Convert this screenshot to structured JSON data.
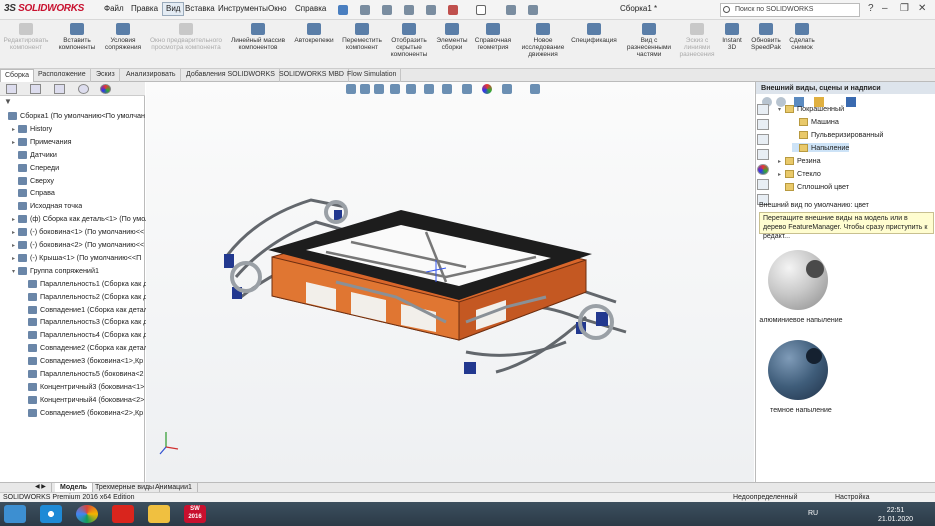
{
  "titlebar": {
    "logo_ds": "3S",
    "logo_name": "SOLIDWORKS",
    "menus": [
      "Файл",
      "Правка",
      "Вид",
      "Вставка",
      "Инструменты",
      "Окно",
      "Справка"
    ],
    "doc_title": "Сборка1 *",
    "search_placeholder": "Поиск по SOLIDWORKS",
    "search_glyph": "🔍",
    "help_glyph": "?",
    "min_glyph": "–",
    "max_glyph": "❐",
    "close_glyph": "✕"
  },
  "ribbon": {
    "items": [
      {
        "label": "Редактировать компонент",
        "disabled": true
      },
      {
        "label": "Вставить компоненты",
        "disabled": false
      },
      {
        "label": "Условия сопряжения",
        "disabled": false
      },
      {
        "label": "Окно предварительного просмотра компонента",
        "disabled": true
      },
      {
        "label": "Линейный массив компонентов",
        "disabled": false
      },
      {
        "label": "Автокрепежи",
        "disabled": false
      },
      {
        "label": "Переместить компонент",
        "disabled": false
      },
      {
        "label": "Отобразить скрытые компоненты",
        "disabled": false
      },
      {
        "label": "Элементы сборки",
        "disabled": false
      },
      {
        "label": "Справочная геометрия",
        "disabled": false
      },
      {
        "label": "Новое исследование движения",
        "disabled": false
      },
      {
        "label": "Спецификация",
        "disabled": false
      },
      {
        "label": "Вид с разнесенными частями",
        "disabled": false
      },
      {
        "label": "Эскиз с линиями разнесения",
        "disabled": true
      },
      {
        "label": "Instant 3D",
        "disabled": false
      },
      {
        "label": "Обновить SpeedPak",
        "disabled": false
      },
      {
        "label": "Сделать снимок",
        "disabled": false
      }
    ]
  },
  "command_tabs": [
    "Сборка",
    "Расположение",
    "Эскиз",
    "Анализировать",
    "Добавления SOLIDWORKS",
    "SOLIDWORKS MBD",
    "Flow Simulation"
  ],
  "feature_tree": {
    "filter_glyph": "▼",
    "items": [
      {
        "label": "Сборка1  (По умолчанию<По умолчан",
        "indent": 0,
        "expander": ""
      },
      {
        "label": "History",
        "indent": 1,
        "expander": "▸"
      },
      {
        "label": "Примечания",
        "indent": 1,
        "expander": "▸"
      },
      {
        "label": "Датчики",
        "indent": 1,
        "expander": ""
      },
      {
        "label": "Спереди",
        "indent": 1,
        "expander": ""
      },
      {
        "label": "Сверху",
        "indent": 1,
        "expander": ""
      },
      {
        "label": "Справа",
        "indent": 1,
        "expander": ""
      },
      {
        "label": "Исходная точка",
        "indent": 1,
        "expander": ""
      },
      {
        "label": "(ф) Сборка как деталь<1> (По умол",
        "indent": 1,
        "expander": "▸"
      },
      {
        "label": "(-) боковина<1> (По умолчанию<<",
        "indent": 1,
        "expander": "▸"
      },
      {
        "label": "(-) боковина<2> (По умолчанию<<",
        "indent": 1,
        "expander": "▸"
      },
      {
        "label": "(-) Крыша<1> (По умолчанию<<П",
        "indent": 1,
        "expander": "▸"
      },
      {
        "label": "Группа сопряжений1",
        "indent": 1,
        "expander": "▾"
      },
      {
        "label": "Параллельность1 (Сборка как д",
        "indent": 2,
        "expander": ""
      },
      {
        "label": "Параллельность2 (Сборка как д",
        "indent": 2,
        "expander": ""
      },
      {
        "label": "Совпадение1 (Сборка как детал",
        "indent": 2,
        "expander": ""
      },
      {
        "label": "Параллельность3 (Сборка как д",
        "indent": 2,
        "expander": ""
      },
      {
        "label": "Параллельность4 (Сборка как д",
        "indent": 2,
        "expander": ""
      },
      {
        "label": "Совпадение2 (Сборка как детал",
        "indent": 2,
        "expander": ""
      },
      {
        "label": "Совпадение3 (боковина<1>,Кр",
        "indent": 2,
        "expander": ""
      },
      {
        "label": "Параллельность5 (боковина<2",
        "indent": 2,
        "expander": ""
      },
      {
        "label": "Концентричный3 (боковина<1>",
        "indent": 2,
        "expander": ""
      },
      {
        "label": "Концентричный4 (боковина<2>",
        "indent": 2,
        "expander": ""
      },
      {
        "label": "Совпадение5 (боковина<2>,Кр",
        "indent": 2,
        "expander": ""
      }
    ]
  },
  "task_pane": {
    "title": "Внешний виды, сцены и надписи",
    "folders": [
      {
        "label": "Покрашенный",
        "indent": 0,
        "expander": "▾",
        "selected": false
      },
      {
        "label": "Машина",
        "indent": 1,
        "expander": "",
        "selected": false
      },
      {
        "label": "Пульверизированный",
        "indent": 1,
        "expander": "",
        "selected": false
      },
      {
        "label": "Напыление",
        "indent": 1,
        "expander": "",
        "selected": true
      },
      {
        "label": "Резина",
        "indent": 0,
        "expander": "▸",
        "selected": false
      },
      {
        "label": "Стекло",
        "indent": 0,
        "expander": "▸",
        "selected": false
      },
      {
        "label": "Сплошной цвет",
        "indent": 0,
        "expander": "",
        "selected": false
      }
    ],
    "default_label": "Внешний вид по умолчанию: цвет",
    "tip": "Перетащите внешние виды на модель или в дерево FeatureManager.  Чтобы сразу приступить к редакт...",
    "swatches": [
      {
        "caption": "алюминиевое напыление",
        "color": "#c9c9c9"
      },
      {
        "caption": "темное напыление",
        "color": "#3f5d7a"
      }
    ]
  },
  "bottom_tabs": [
    "Модель",
    "Трехмерные виды",
    "Анимации1"
  ],
  "status": {
    "edition": "SOLIDWORKS Premium 2016 x64 Edition",
    "state": "Недоопределенный",
    "mode": "Настройка"
  },
  "taskbar": {
    "lang": "RU",
    "time": "22:51",
    "date": "21.01.2020",
    "sw_label": "SW 2016"
  }
}
